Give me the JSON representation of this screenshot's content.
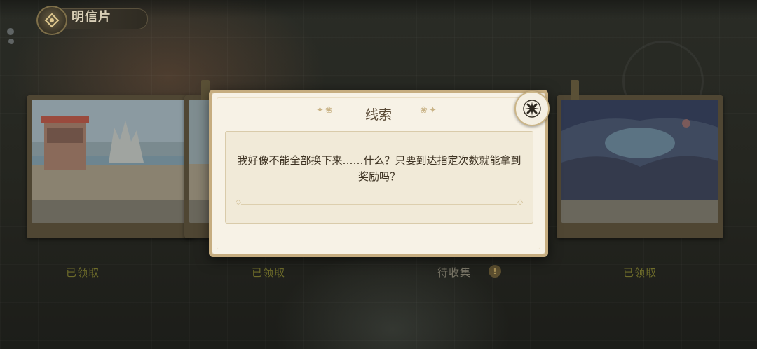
{
  "header": {
    "title": "明信片",
    "back_icon": "back-emblem-icon"
  },
  "cards": [
    {
      "status": "已领取",
      "scene": "beach-shop-castle"
    },
    {
      "status": "已领取",
      "scene": "beach"
    },
    {
      "status": "待收集",
      "scene": "hidden"
    },
    {
      "status": "已领取",
      "scene": "cave"
    }
  ],
  "modal": {
    "title": "线索",
    "message": "我好像不能全部换下来……什么？只要到达指定次数就能拿到奖励吗？",
    "close_icon": "close-x-icon"
  },
  "colors": {
    "collected": "#6e6c2a",
    "pending": "#7a7667",
    "modal_bg": "#f7f2e6",
    "modal_border": "#c6ad80"
  }
}
